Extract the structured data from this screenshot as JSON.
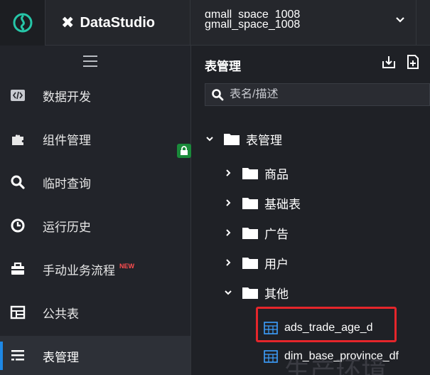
{
  "app": {
    "name": "DataStudio",
    "workspace_line1": "gmall_space_1008",
    "workspace_line2": "gmall_space_1008"
  },
  "nav": {
    "items": [
      {
        "label": "数据开发",
        "icon": "code-icon"
      },
      {
        "label": "组件管理",
        "icon": "puzzle-icon"
      },
      {
        "label": "临时查询",
        "icon": "search-icon"
      },
      {
        "label": "运行历史",
        "icon": "clock-icon"
      },
      {
        "label": "手动业务流程",
        "icon": "briefcase-icon",
        "badge": "NEW"
      },
      {
        "label": "公共表",
        "icon": "table-icon"
      },
      {
        "label": "表管理",
        "icon": "list-icon",
        "active": true
      }
    ]
  },
  "panel": {
    "title": "表管理",
    "search_placeholder": "表名/描述",
    "tree": {
      "root": "表管理",
      "folders": [
        "商品",
        "基础表",
        "广告",
        "用户",
        "其他"
      ],
      "tables": [
        "ads_trade_age_d",
        "dim_base_province_df"
      ]
    }
  },
  "watermark": "生产环境",
  "colors": {
    "accent": "#1e88e5",
    "folder": "#ffffff",
    "highlight": "#e5262b",
    "lock_badge": "#1a8a3a",
    "new_badge": "#ff4d4f"
  }
}
